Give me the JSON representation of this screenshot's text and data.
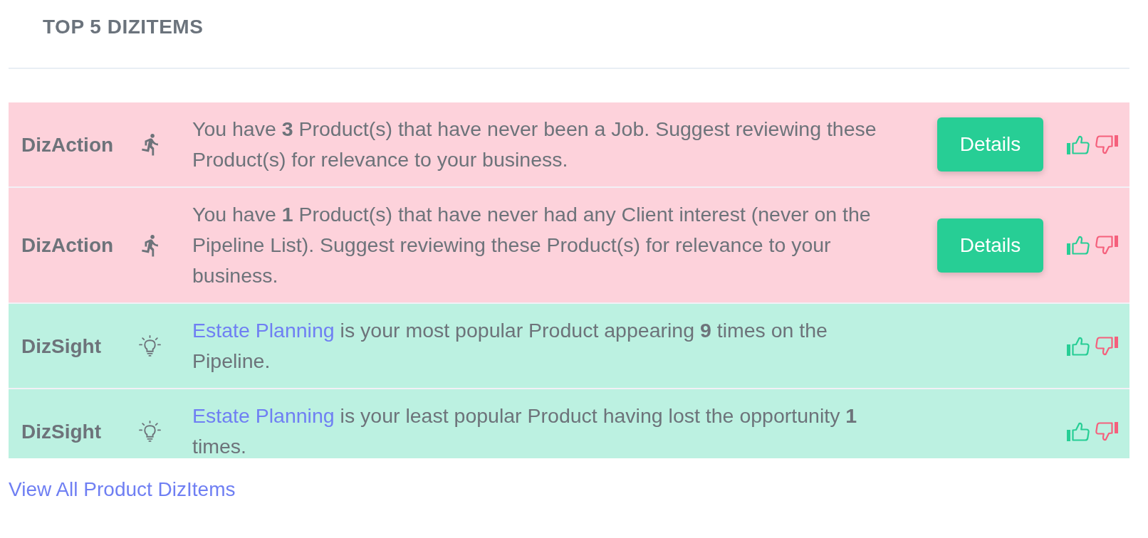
{
  "title": "TOP 5 DIZITEMS",
  "items": [
    {
      "kind": "action",
      "label": "DizAction",
      "text": "You have **3** Product(s) that have never been a Job. Suggest reviewing these Product(s) for relevance to your business.",
      "button": "Details"
    },
    {
      "kind": "action",
      "label": "DizAction",
      "text": "You have **1** Product(s) that have never had any Client interest (never on the Pipeline List). Suggest reviewing these Product(s) for relevance to your business.",
      "button": "Details"
    },
    {
      "kind": "sight",
      "label": "DizSight",
      "link": "Estate Planning",
      "text": "is your most popular Product appearing **9** times on the Pipeline."
    },
    {
      "kind": "sight",
      "label": "DizSight",
      "link": "Estate Planning",
      "text": "is your least popular Product having lost the opportunity **1** times."
    }
  ],
  "footer_link": "View All Product DizItems"
}
